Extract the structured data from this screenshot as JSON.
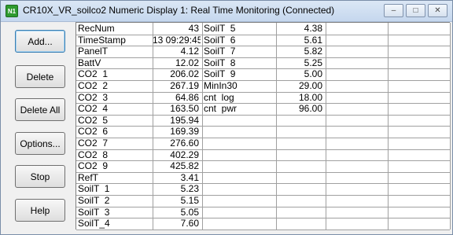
{
  "window": {
    "title": "CR10X_VR_soilco2 Numeric Display 1: Real Time Monitoring (Connected)",
    "icon_text": "N1",
    "minimize_glyph": "–",
    "maximize_glyph": "□",
    "close_glyph": "✕"
  },
  "buttons": {
    "add": "Add...",
    "delete": "Delete",
    "delete_all": "Delete All",
    "options": "Options...",
    "stop": "Stop",
    "help": "Help"
  },
  "columns": [
    {
      "rows": [
        {
          "name": "RecNum",
          "value": "43"
        },
        {
          "name": "TimeStamp",
          "value": "13 09:29:45"
        },
        {
          "name": "PanelT",
          "value": "4.12"
        },
        {
          "name": "BattV",
          "value": "12.02"
        },
        {
          "name": "CO2  1",
          "value": "206.02"
        },
        {
          "name": "CO2  2",
          "value": "267.19"
        },
        {
          "name": "CO2  3",
          "value": "64.86"
        },
        {
          "name": "CO2  4",
          "value": "163.50"
        },
        {
          "name": "CO2  5",
          "value": "195.94"
        },
        {
          "name": "CO2  6",
          "value": "169.39"
        },
        {
          "name": "CO2  7",
          "value": "276.60"
        },
        {
          "name": "CO2  8",
          "value": "402.29"
        },
        {
          "name": "CO2  9",
          "value": "425.82"
        },
        {
          "name": "RefT",
          "value": "3.41"
        },
        {
          "name": "SoilT  1",
          "value": "5.23"
        },
        {
          "name": "SoilT  2",
          "value": "5.15"
        },
        {
          "name": "SoilT  3",
          "value": "5.05"
        },
        {
          "name": "SoilT_4",
          "value": "7.60"
        }
      ]
    },
    {
      "rows": [
        {
          "name": "SoilT  5",
          "value": "4.38"
        },
        {
          "name": "SoilT  6",
          "value": "5.61"
        },
        {
          "name": "SoilT  7",
          "value": "5.82"
        },
        {
          "name": "SoilT  8",
          "value": "5.25"
        },
        {
          "name": "SoilT  9",
          "value": "5.00"
        },
        {
          "name": "MinIn30",
          "value": "29.00"
        },
        {
          "name": "cnt  log",
          "value": "18.00"
        },
        {
          "name": "cnt  pwr",
          "value": "96.00"
        },
        {
          "name": "",
          "value": ""
        },
        {
          "name": "",
          "value": ""
        },
        {
          "name": "",
          "value": ""
        },
        {
          "name": "",
          "value": ""
        },
        {
          "name": "",
          "value": ""
        },
        {
          "name": "",
          "value": ""
        },
        {
          "name": "",
          "value": ""
        },
        {
          "name": "",
          "value": ""
        },
        {
          "name": "",
          "value": ""
        },
        {
          "name": "",
          "value": ""
        }
      ]
    },
    {
      "rows": [
        {
          "name": "",
          "value": ""
        },
        {
          "name": "",
          "value": ""
        },
        {
          "name": "",
          "value": ""
        },
        {
          "name": "",
          "value": ""
        },
        {
          "name": "",
          "value": ""
        },
        {
          "name": "",
          "value": ""
        },
        {
          "name": "",
          "value": ""
        },
        {
          "name": "",
          "value": ""
        },
        {
          "name": "",
          "value": ""
        },
        {
          "name": "",
          "value": ""
        },
        {
          "name": "",
          "value": ""
        },
        {
          "name": "",
          "value": ""
        },
        {
          "name": "",
          "value": ""
        },
        {
          "name": "",
          "value": ""
        },
        {
          "name": "",
          "value": ""
        },
        {
          "name": "",
          "value": ""
        },
        {
          "name": "",
          "value": ""
        },
        {
          "name": "",
          "value": ""
        }
      ]
    }
  ]
}
